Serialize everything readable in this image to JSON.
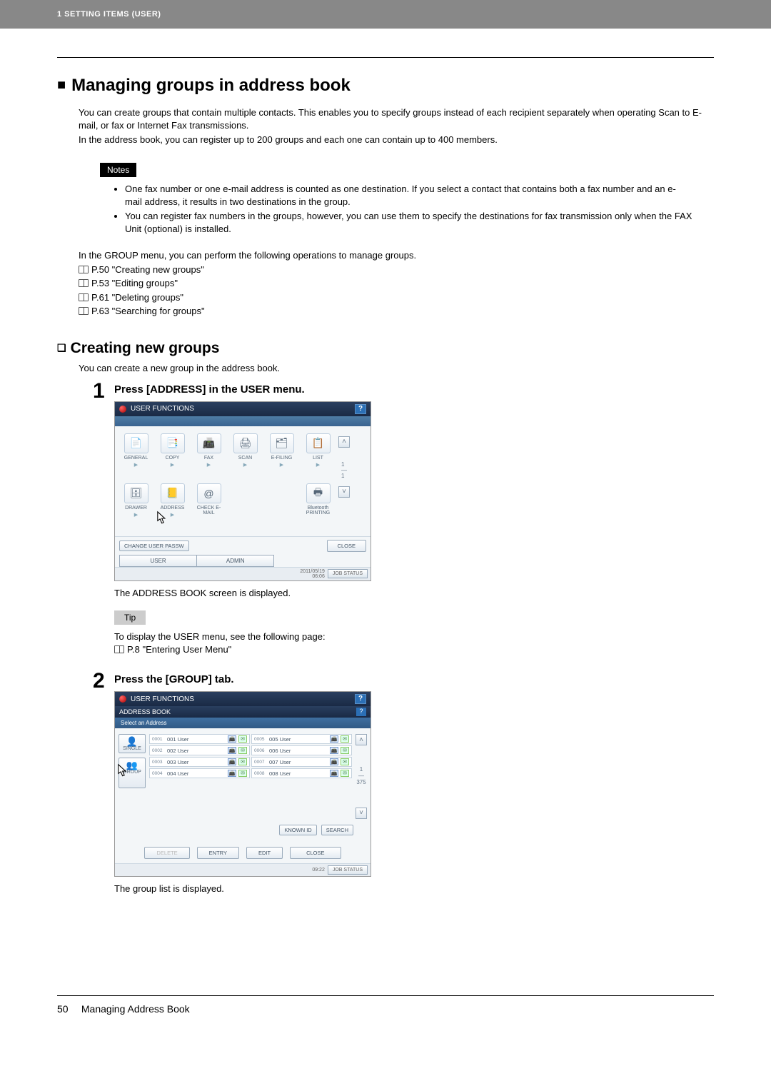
{
  "header": {
    "chapter": "1 SETTING ITEMS (USER)"
  },
  "h1": "Managing groups in address book",
  "intro": {
    "p1": "You can create groups that contain multiple contacts. This enables you to specify groups instead of each recipient separately when operating Scan to E-mail, or fax or Internet Fax transmissions.",
    "p2": "In the address book, you can register up to 200 groups and each one can contain up to 400 members."
  },
  "notes_label": "Notes",
  "notes": [
    "One fax number or one e-mail address is counted as one destination. If you select a contact that contains both a fax number and an e-mail address, it results in two destinations in the group.",
    "You can register fax numbers in the groups, however, you can use them to specify the destinations for fax transmission only when the FAX Unit (optional) is installed."
  ],
  "group_menu": {
    "lead": "In the GROUP menu, you can perform the following operations to manage groups.",
    "items": [
      "P.50 \"Creating new groups\"",
      "P.53 \"Editing groups\"",
      "P.61 \"Deleting groups\"",
      "P.63 \"Searching for groups\""
    ]
  },
  "h2": "Creating new groups",
  "h2_intro": "You can create a new group in the address book.",
  "steps": {
    "s1": {
      "num": "1",
      "title": "Press [ADDRESS] in the USER menu.",
      "after": "The ADDRESS BOOK screen is displayed.",
      "tip_label": "Tip",
      "tip_text": "To display the USER menu, see the following page:",
      "tip_ref": "P.8 \"Entering User Menu\""
    },
    "s2": {
      "num": "2",
      "title": "Press the [GROUP] tab.",
      "after": "The group list is displayed."
    }
  },
  "panel1": {
    "title": "USER FUNCTIONS",
    "row1": [
      "GENERAL",
      "COPY",
      "FAX",
      "SCAN",
      "E-FILING",
      "LIST"
    ],
    "row2": [
      "DRAWER",
      "ADDRESS",
      "CHECK E-MAIL",
      "",
      "",
      "Bluetooth PRINTING"
    ],
    "change_pass": "CHANGE USER PASSW",
    "close": "CLOSE",
    "tabs": [
      "USER",
      "ADMIN"
    ],
    "date": "2011/05/19",
    "time": "06:06",
    "jobstat": "JOB STATUS",
    "scroll_top": "1",
    "scroll_bottom": "1"
  },
  "panel2": {
    "title": "USER FUNCTIONS",
    "sub": "ADDRESS BOOK",
    "select": "Select an Address",
    "side": {
      "single": "SINGLE",
      "group": "GROUP"
    },
    "left": [
      {
        "n": "0001",
        "u": "001 User"
      },
      {
        "n": "0002",
        "u": "002 User"
      },
      {
        "n": "0003",
        "u": "003 User"
      },
      {
        "n": "0004",
        "u": "004 User"
      }
    ],
    "right": [
      {
        "n": "0005",
        "u": "005 User"
      },
      {
        "n": "0006",
        "u": "006 User"
      },
      {
        "n": "0007",
        "u": "007 User"
      },
      {
        "n": "0008",
        "u": "008 User"
      }
    ],
    "scroll": {
      "pos": "1",
      "total": "375"
    },
    "known": "KNOWN ID",
    "search": "SEARCH",
    "actions": {
      "delete": "DELETE",
      "entry": "ENTRY",
      "edit": "EDIT",
      "close": "CLOSE"
    },
    "time": "09:22",
    "jobstat": "JOB STATUS"
  },
  "footer": {
    "page": "50",
    "title": "Managing Address Book"
  }
}
